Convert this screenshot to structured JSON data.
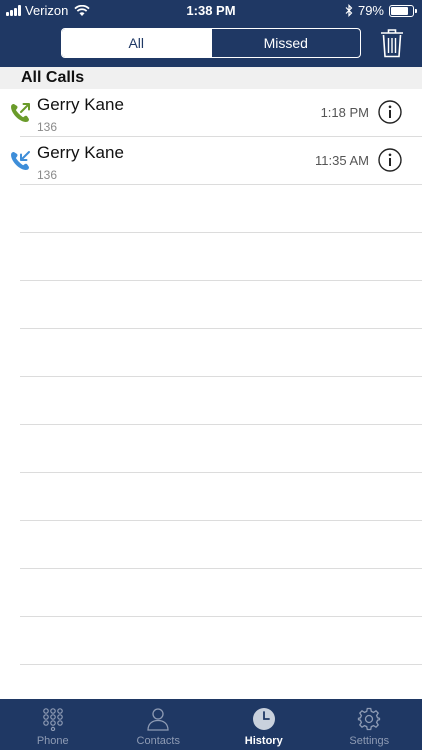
{
  "status_bar": {
    "carrier": "Verizon",
    "time": "1:38 PM",
    "battery": "79%",
    "battery_level": 0.79,
    "icons": [
      "signal-icon",
      "wifi-icon",
      "bluetooth-icon",
      "battery-icon"
    ]
  },
  "toolbar": {
    "segments": [
      {
        "label": "All",
        "selected": true
      },
      {
        "label": "Missed",
        "selected": false
      }
    ],
    "trash_icon": "trash-icon"
  },
  "section": {
    "title": "All Calls"
  },
  "calls": [
    {
      "name": "Gerry Kane",
      "number": "136",
      "time": "1:18 PM",
      "direction": "outgoing",
      "icon": "outgoing-call-icon",
      "icon_color": "#6a9b2a"
    },
    {
      "name": "Gerry Kane",
      "number": "136",
      "time": "11:35 AM",
      "direction": "incoming",
      "icon": "incoming-call-icon",
      "icon_color": "#3e8ed9"
    }
  ],
  "tabbar": {
    "tabs": [
      {
        "label": "Phone",
        "icon": "keypad-icon",
        "active": false
      },
      {
        "label": "Contacts",
        "icon": "person-icon",
        "active": false
      },
      {
        "label": "History",
        "icon": "clock-icon",
        "active": true
      },
      {
        "label": "Settings",
        "icon": "gear-icon",
        "active": false
      }
    ]
  },
  "colors": {
    "header_bg": "#1f3864",
    "tab_inactive": "#8e9bb4",
    "section_bg": "#f0f0f0"
  }
}
